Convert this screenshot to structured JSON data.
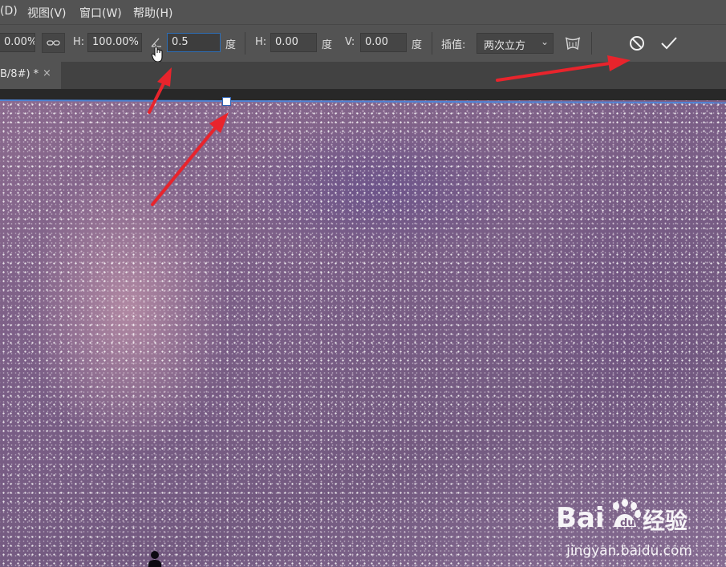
{
  "menu": {
    "items": [
      {
        "label": "(D)"
      },
      {
        "label": "视图(V)"
      },
      {
        "label": "窗口(W)"
      },
      {
        "label": "帮助(H)"
      }
    ]
  },
  "options": {
    "w_value": "0.00%",
    "h_label": "H:",
    "h_value": "100.00%",
    "angle_value": "0.5",
    "degree": "度",
    "hskew_label": "H:",
    "hskew_value": "0.00",
    "vskew_label": "V:",
    "vskew_value": "0.00",
    "interp_label": "插值:",
    "interp_value": "两次立方"
  },
  "tab": {
    "title": "B/8#) *",
    "close": "×"
  },
  "watermark": {
    "text": "jingyan.baidu.com",
    "brand": "Baidu经验"
  },
  "colors": {
    "menubar": "#535353",
    "selection_line": "#4f84d6",
    "arrow": "#e8242c"
  },
  "icons": [
    "link-icon",
    "angle-icon",
    "hand-cursor-icon",
    "warp-icon",
    "cancel-icon",
    "commit-check-icon",
    "chevron-down-icon",
    "close-icon"
  ]
}
